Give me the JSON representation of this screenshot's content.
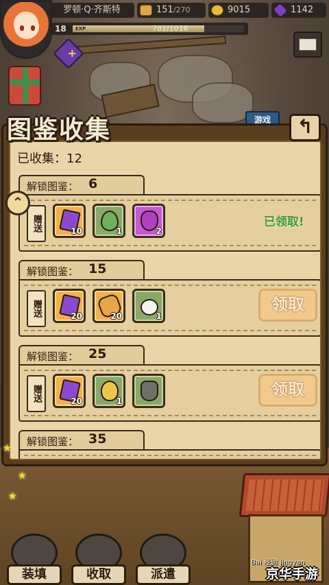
{
  "player": {
    "name": "罗顿·Q·齐斯特",
    "level": "18",
    "exp_tag": "EXP",
    "exp_text": "781/1016",
    "exp_fraction": 0.769
  },
  "resources": {
    "bread": "151",
    "bread_max": "/270",
    "gold": "9015",
    "gems": "1142"
  },
  "scene": {
    "game_sign": "游戏"
  },
  "panel": {
    "title": "图鉴收集",
    "back_icon": "↰",
    "collected_label": "已收集：12"
  },
  "gift_tag_text": "赠送",
  "rewards": [
    {
      "label": "解锁图鉴：",
      "threshold": "6",
      "items": [
        {
          "icon": "purple-gem-icon",
          "count": "10",
          "frame": "orange"
        },
        {
          "icon": "leaf-icon",
          "count": "1",
          "frame": "green"
        },
        {
          "icon": "potion-icon",
          "count": "2",
          "frame": "purple"
        }
      ],
      "status": "claimed",
      "status_text": "已领取!"
    },
    {
      "label": "解锁图鉴：",
      "threshold": "15",
      "items": [
        {
          "icon": "purple-gem-icon",
          "count": "20",
          "frame": "orange"
        },
        {
          "icon": "bread-icon",
          "count": "20",
          "frame": "orange"
        },
        {
          "icon": "turnip-icon",
          "count": "1",
          "frame": "green"
        }
      ],
      "status": "claim",
      "status_text": "领取"
    },
    {
      "label": "解锁图鉴：",
      "threshold": "25",
      "items": [
        {
          "icon": "purple-gem-icon",
          "count": "20",
          "frame": "orange"
        },
        {
          "icon": "golden-egg-icon",
          "count": "1",
          "frame": "green"
        },
        {
          "icon": "gauntlet-icon",
          "count": "",
          "frame": "green"
        }
      ],
      "status": "claim",
      "status_text": "领取"
    },
    {
      "label": "解锁图鉴：",
      "threshold": "35"
    }
  ],
  "bottom_nav": [
    "装填",
    "收取",
    "派遣"
  ],
  "watermark": {
    "baidu": "Bai 经验",
    "sub": "jingyan",
    "brand": "京华手游"
  }
}
